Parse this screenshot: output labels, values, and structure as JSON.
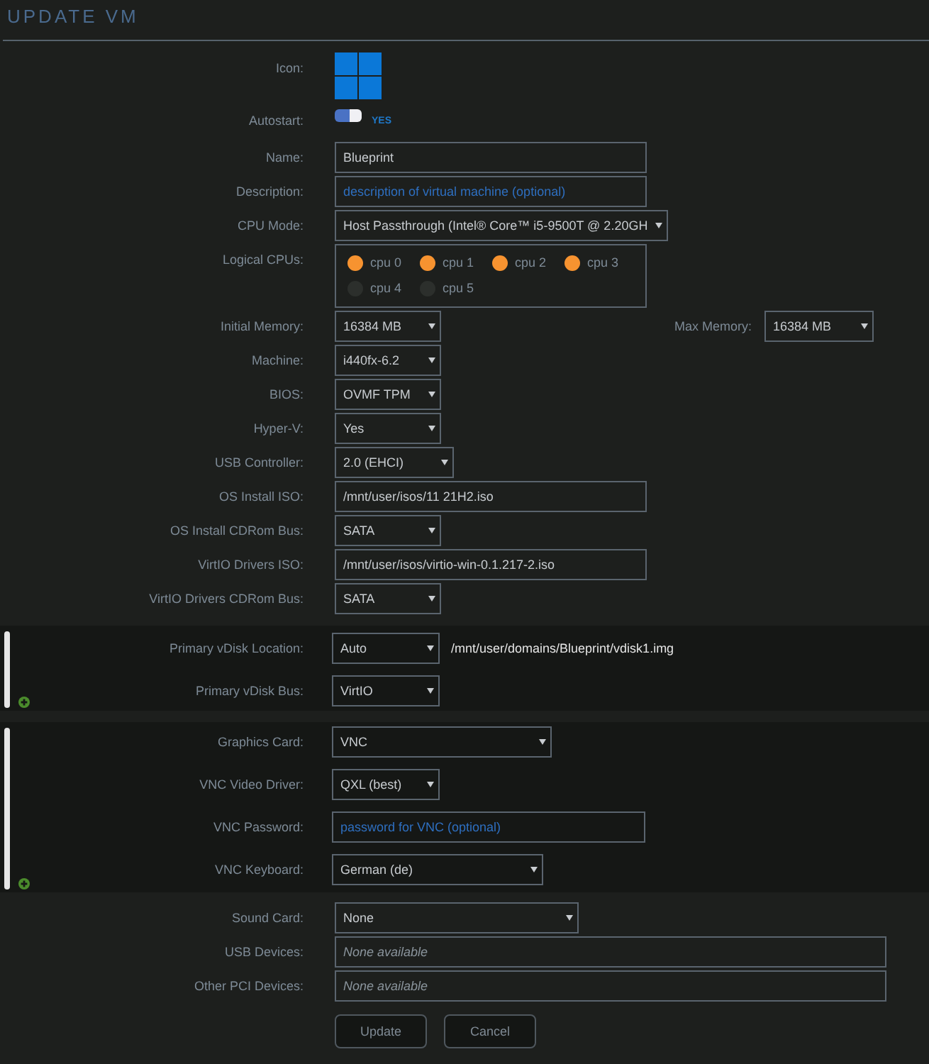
{
  "title": "UPDATE VM",
  "sections": [
    {
      "kind": "plain",
      "rows": [
        {
          "kind": "icon",
          "label": "Icon:"
        },
        {
          "kind": "toggle",
          "label": "Autostart:",
          "on": true,
          "state_label": "YES"
        },
        {
          "kind": "input",
          "label": "Name:",
          "value": "Blueprint"
        },
        {
          "kind": "input",
          "label": "Description:",
          "placeholder": "description of virtual machine (optional)"
        },
        {
          "kind": "select",
          "label": "CPU Mode:",
          "value": "Host Passthrough (Intel® Core™ i5-9500T @ 2.20GH"
        },
        {
          "kind": "cpus",
          "label": "Logical CPUs:",
          "cpus": [
            {
              "label": "cpu 0",
              "checked": true
            },
            {
              "label": "cpu 1",
              "checked": true
            },
            {
              "label": "cpu 2",
              "checked": true
            },
            {
              "label": "cpu 3",
              "checked": true
            },
            {
              "label": "cpu 4",
              "checked": false
            },
            {
              "label": "cpu 5",
              "checked": false
            }
          ]
        },
        {
          "kind": "memory",
          "label": "Initial Memory:",
          "value": "16384 MB",
          "max_label": "Max Memory:",
          "max_value": "16384 MB"
        },
        {
          "kind": "select",
          "label": "Machine:",
          "value": "i440fx-6.2"
        },
        {
          "kind": "select",
          "label": "BIOS:",
          "value": "OVMF TPM"
        },
        {
          "kind": "select",
          "label": "Hyper-V:",
          "value": "Yes"
        },
        {
          "kind": "select",
          "label": "USB Controller:",
          "value": "2.0 (EHCI)"
        },
        {
          "kind": "input",
          "label": "OS Install ISO:",
          "value": "/mnt/user/isos/11 21H2.iso"
        },
        {
          "kind": "select",
          "label": "OS Install CDRom Bus:",
          "value": "SATA"
        },
        {
          "kind": "input",
          "label": "VirtIO Drivers ISO:",
          "value": "/mnt/user/isos/virtio-win-0.1.217-2.iso"
        },
        {
          "kind": "select",
          "label": "VirtIO Drivers CDRom Bus:",
          "value": "SATA"
        }
      ]
    },
    {
      "kind": "panel",
      "rows": [
        {
          "kind": "select_path",
          "label": "Primary vDisk Location:",
          "value": "Auto",
          "path": "/mnt/user/domains/Blueprint/vdisk1.img"
        },
        {
          "kind": "select",
          "label": "Primary vDisk Bus:",
          "value": "VirtIO"
        }
      ]
    },
    {
      "kind": "panel",
      "rows": [
        {
          "kind": "select",
          "label": "Graphics Card:",
          "value": "VNC"
        },
        {
          "kind": "select",
          "label": "VNC Video Driver:",
          "value": "QXL (best)"
        },
        {
          "kind": "input",
          "label": "VNC Password:",
          "placeholder": "password for VNC (optional)"
        },
        {
          "kind": "select",
          "label": "VNC Keyboard:",
          "value": "German (de)"
        }
      ]
    },
    {
      "kind": "plain",
      "rows": [
        {
          "kind": "select",
          "label": "Sound Card:",
          "value": "None"
        },
        {
          "kind": "devices",
          "label": "USB Devices:",
          "note": "None available"
        },
        {
          "kind": "devices",
          "label": "Other PCI Devices:",
          "note": "None available"
        }
      ]
    }
  ],
  "buttons": [
    {
      "label": "Update"
    },
    {
      "label": "Cancel"
    }
  ]
}
